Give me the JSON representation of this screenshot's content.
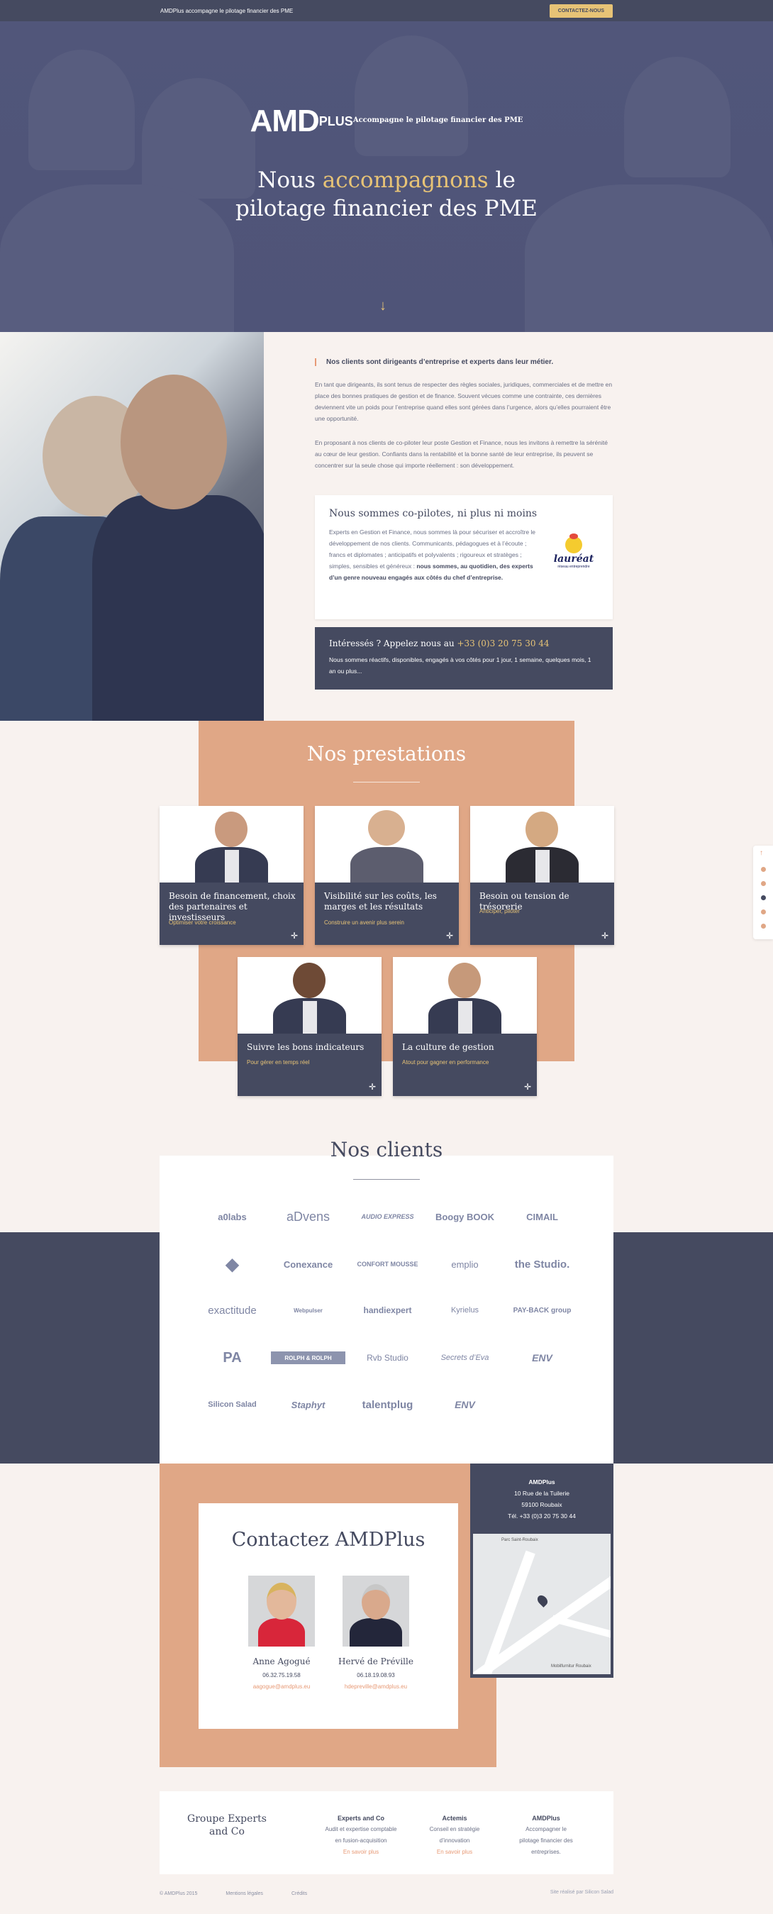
{
  "topbar": {
    "tagline": "AMDPlus accompagne le pilotage financier des PME",
    "cta": "CONTACTEZ-NOUS"
  },
  "hero": {
    "logo": "AMD",
    "logo_plus": "PLUS",
    "logo_sub": "Accompagne le pilotage financier des PME",
    "title_before": "Nous ",
    "title_highlight": "accompagnons",
    "title_after": " le",
    "title_line2": "pilotage financier des PME",
    "scroll_icon": "arrow-down-icon"
  },
  "intro": {
    "lead": "Nos clients sont dirigeants d’entreprise et experts dans leur métier.",
    "p1": "En tant que dirigeants, ils sont tenus de respecter des règles sociales, juridiques, commerciales et de mettre en place des bonnes pratiques de gestion et de finance. Souvent vécues comme une contrainte, ces dernières deviennent vite un poids pour l’entreprise quand elles sont gérées dans l’urgence, alors qu’elles pourraient être une opportunité.",
    "p2": "En proposant à nos clients de co-piloter leur poste Gestion et Finance, nous les invitons à remettre la sérénité au cœur de leur gestion. Confiants dans la rentabilité et la bonne santé de leur entreprise, ils peuvent se concentrer sur la seule chose qui importe réellement : son développement."
  },
  "copilot": {
    "title": "Nous sommes co-pilotes, ni plus ni moins",
    "text": "Experts en Gestion et Finance, nous sommes là pour sécuriser et accroître le développement de nos clients. Communicants, pédagogues et à l’écoute ; francs et diplomates ; anticipatifs et polyvalents ; rigoureux et stratèges ; simples, sensibles et généreux : ",
    "text_bold": "nous sommes, au quotidien, des experts d’un genre nouveau engagés aux côtés du chef d’entreprise.",
    "badge": "lauréat",
    "badge_sub": "réseau entreprendre"
  },
  "call": {
    "title": "Intéressés ?  Appelez nous au ",
    "phone": "+33 (0)3 20 75 30 44",
    "text": "Nous sommes réactifs, disponibles, engagés à vos côtés pour 1 jour, 1 semaine, quelques mois, 1 an ou plus..."
  },
  "prestations": {
    "title": "Nos prestations",
    "cards": [
      {
        "title": "Besoin de financement, choix des partenaires et investisseurs",
        "subtitle": "Optimiser votre croissance"
      },
      {
        "title": "Visibilité sur les coûts, les marges et les résultats",
        "subtitle": "Construire un avenir plus serein"
      },
      {
        "title": "Besoin ou tension de trésorerie",
        "subtitle": "Anticiper, piloter"
      },
      {
        "title": "Suivre les bons indicateurs",
        "subtitle": "Pour gérer en temps réel"
      },
      {
        "title": "La culture de gestion",
        "subtitle": "Atout pour gagner en performance"
      }
    ]
  },
  "clients": {
    "title": "Nos clients",
    "logos": [
      "a0labs",
      "aDvens",
      "AUDIO EXPRESS",
      "Boogy BOOK",
      "CIMAIL",
      "◆",
      "Conexance",
      "CONFORT MOUSSE",
      "emplio",
      "the Studio.",
      "exactitude",
      "Webpulser",
      "handiexpert",
      "Kyrielus",
      "PAY-BACK group",
      "PA",
      "ROLPH & ROLPH",
      "Rvb Studio",
      "Secrets d’Eva",
      "ENV",
      "Silicon Salad",
      "Staphyt",
      "talentplug",
      "ENV"
    ]
  },
  "contact": {
    "title": "Contactez AMDPlus",
    "people": [
      {
        "name": "Anne Agogué",
        "phone": "06.32.75.19.58",
        "email": "aagogue@amdplus.eu"
      },
      {
        "name": "Hervé de Préville",
        "phone": "06.18.19.08.93",
        "email": "hdepreville@amdplus.eu"
      }
    ],
    "address": {
      "name": "AMDPlus",
      "street": "10 Rue de la Tuilerie",
      "city": "59100 Roubaix",
      "phone": "Tél. +33 (0)3 20 75 30 44"
    },
    "map_labels": [
      "Parc Saint-Roubaix",
      "Mobilfurnitur Roubaix"
    ]
  },
  "footer": {
    "group": "Groupe Experts and Co",
    "cols": [
      {
        "title": "Experts and Co",
        "text": "Audit et expertise comptable en fusion-acquisition",
        "link": "En savoir plus"
      },
      {
        "title": "Actemis",
        "text": "Conseil en stratégie d’innovation",
        "link": "En savoir plus"
      },
      {
        "title": "AMDPlus",
        "text": "Accompagner le pilotage financier des entreprises.",
        "link": ""
      }
    ],
    "copyright": "© AMDPlus 2015",
    "legal": "Mentions légales",
    "credits": "Crédits",
    "made_by": "Site réalisé par  Silicon Salad"
  },
  "colors": {
    "navy": "#454a60",
    "accent": "#e7c376",
    "peach": "#e0a786",
    "cream": "#f8f2ef"
  }
}
